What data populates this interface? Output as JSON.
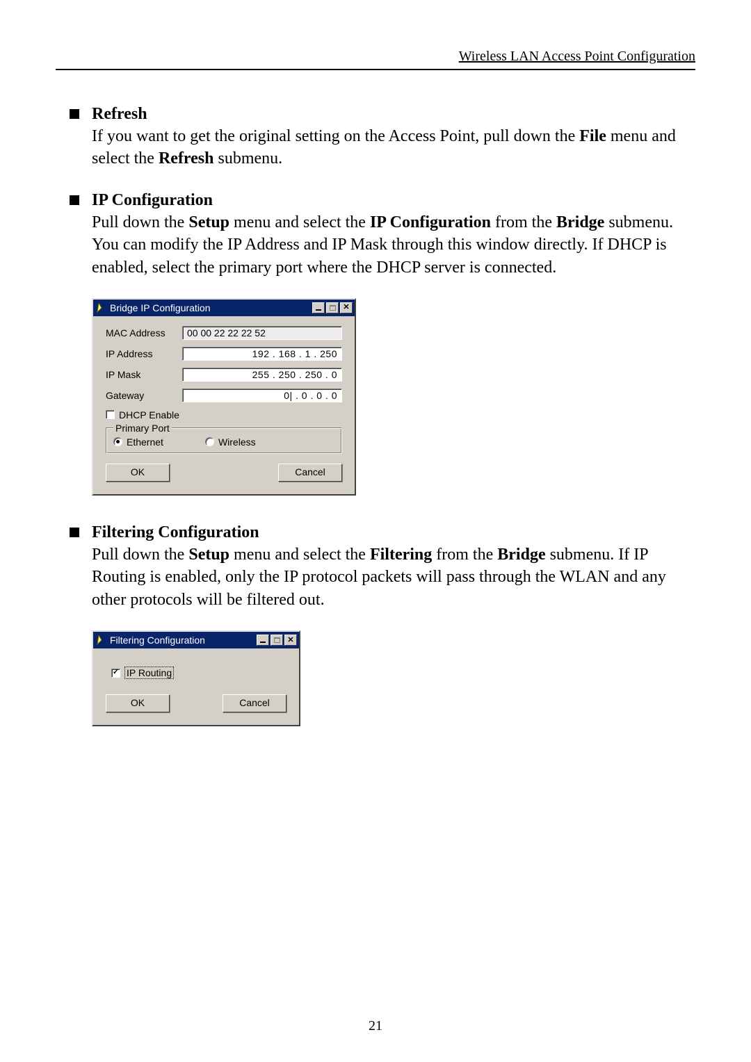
{
  "header": {
    "running_head": "Wireless LAN Access Point Configuration"
  },
  "sections": {
    "refresh": {
      "title": "Refresh",
      "p1a": "If you want to get the original setting on the Access Point, pull down the ",
      "p1b": "File",
      "p1c": " menu and select the ",
      "p1d": "Refresh",
      "p1e": " submenu."
    },
    "ipconfig": {
      "title": "IP Configuration",
      "p1a": "Pull down the ",
      "p1b": "Setup",
      "p1c": " menu and select the ",
      "p1d": "IP Configuration",
      "p1e": " from the ",
      "p1f": "Bridge",
      "p1g": " submenu. You can modify the IP Address and IP Mask through this window directly. If DHCP is enabled, select the primary port where the DHCP server is connected."
    },
    "filtering": {
      "title": "Filtering Configuration",
      "p1a": "Pull down the ",
      "p1b": "Setup",
      "p1c": " menu and select the ",
      "p1d": "Filtering",
      "p1e": " from the ",
      "p1f": "Bridge",
      "p1g": " submenu. If IP Routing is enabled, only the IP protocol packets will pass through the WLAN and any other protocols will be filtered out."
    }
  },
  "dialog_ip": {
    "title": "Bridge IP Configuration",
    "labels": {
      "mac": "MAC Address",
      "ip": "IP Address",
      "mask": "IP Mask",
      "gateway": "Gateway",
      "dhcp": "DHCP Enable",
      "primary_port": "Primary Port",
      "ethernet": "Ethernet",
      "wireless": "Wireless"
    },
    "values": {
      "mac": "00 00 22 22 22 52",
      "ip": "192 . 168 .   1   . 250",
      "mask": "255 . 250 . 250 .   0",
      "gateway": "0| .   0   .   0   .   0"
    },
    "buttons": {
      "ok": "OK",
      "cancel": "Cancel"
    }
  },
  "dialog_filter": {
    "title": "Filtering Configuration",
    "labels": {
      "ip_routing": "IP Routing"
    },
    "buttons": {
      "ok": "OK",
      "cancel": "Cancel"
    }
  },
  "page_number": "21"
}
